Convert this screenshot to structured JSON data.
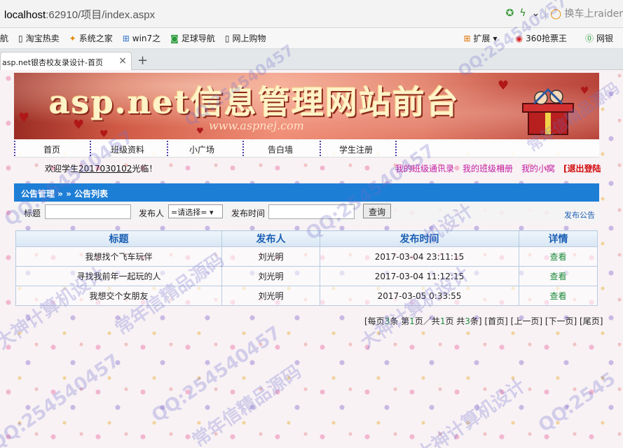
{
  "browser": {
    "address_host": "localhost",
    "address_rest": ":62910/项目/index.aspx",
    "search_hint": "换车上raider",
    "bookmarks": [
      "航",
      "淘宝热卖",
      "系统之家",
      "win7之",
      "足球导航",
      "网上购物"
    ],
    "bookmarks_right": [
      "扩展",
      "360抢票王",
      "网银"
    ],
    "tab_title": "asp.net银杏校友录设计-首页"
  },
  "banner": {
    "title": "asp.net信息管理网站前台",
    "url": "www.aspnej.com"
  },
  "nav": [
    "首页",
    "班级资料",
    "小广场",
    "告白墙",
    "学生注册"
  ],
  "welcome": {
    "prefix": "欢迎学生",
    "user": "2017030102",
    "suffix": "光临！"
  },
  "user_links": [
    "我的班级通讯录",
    "我的班级相册",
    "我的小窝",
    "[退出登陆"
  ],
  "panel": {
    "breadcrumb": "公告管理 » » 公告列表",
    "filter": {
      "title_label": "标题",
      "publisher_label": "发布人",
      "publisher_selected": "=请选择=",
      "time_label": "发布时间",
      "search_button": "查询",
      "publish_link": "发布公告"
    }
  },
  "table": {
    "headers": [
      "标题",
      "发布人",
      "发布时间",
      "详情"
    ],
    "rows": [
      [
        "我想找个飞车玩伴",
        "刘光明",
        "2017-03-04 23:11:15",
        "查看"
      ],
      [
        "寻找我前年一起玩的人",
        "刘光明",
        "2017-03-04 11:12:15",
        "查看"
      ],
      [
        "我想交个女朋友",
        "刘光明",
        "2017-03-05 0:33:55",
        "查看"
      ]
    ]
  },
  "pager": {
    "text_pre": "[每页",
    "per_page": "3",
    "text_mid": "条 第",
    "page": "1",
    "text_mid2": "页／共",
    "pages": "1",
    "text_mid3": "页 共",
    "total": "3",
    "text_end": "条]",
    "first": "[首页]",
    "prev": "[上一页]",
    "next": "[下一页]",
    "last": "[尾页]"
  },
  "watermarks": [
    "QQ:254540457",
    "常年信精品源码",
    "大神计算机设计",
    "QQ:254540457",
    "机设计",
    "QQ:254540457",
    "常年信精品源码",
    "大神计算机设计",
    "QQ:2545",
    "常年信精品源码",
    "QQ:254540457",
    "大神计算机设计",
    "QQ:254540457",
    "QQ:254540457"
  ]
}
